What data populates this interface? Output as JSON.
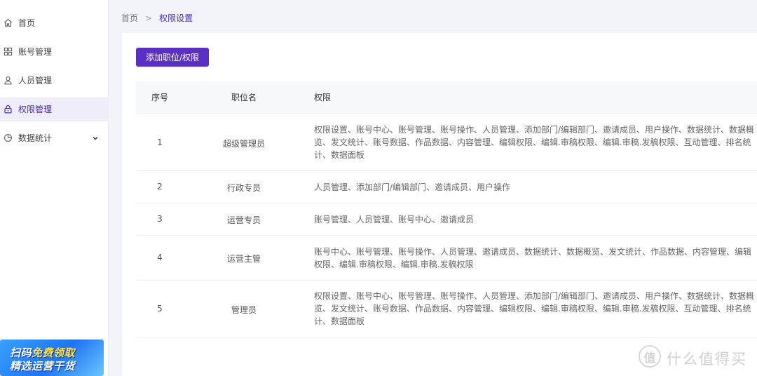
{
  "sidebar": {
    "items": [
      {
        "label": "首页",
        "icon": "home-icon"
      },
      {
        "label": "账号管理",
        "icon": "grid-icon"
      },
      {
        "label": "人员管理",
        "icon": "user-icon"
      },
      {
        "label": "权限管理",
        "icon": "lock-icon",
        "active": true
      },
      {
        "label": "数据统计",
        "icon": "chart-icon"
      }
    ],
    "promo": {
      "line1_a": "扫码",
      "line1_b": "免费领取",
      "line2": "精选运营干货"
    }
  },
  "breadcrumb": {
    "home": "首页",
    "separator": ">",
    "current": "权限设置"
  },
  "toolbar": {
    "add_label": "添加职位/权限"
  },
  "table": {
    "headers": {
      "index": "序号",
      "name": "职位名",
      "permissions": "权限"
    },
    "rows": [
      {
        "index": "1",
        "name": "超级管理员",
        "permissions": "权限设置、账号中心、账号管理、账号操作、人员管理、添加部门/编辑部门、邀请成员、用户操作、数据统计、数据概览、发文统计、账号数据、作品数据、内容管理、编辑权限、编辑.审稿权限、编辑.审稿.发稿权限、互动管理、排名统计、数据面板"
      },
      {
        "index": "2",
        "name": "行政专员",
        "permissions": "人员管理、添加部门/编辑部门、邀请成员、用户操作"
      },
      {
        "index": "3",
        "name": "运营专员",
        "permissions": "账号管理、人员管理、账号中心、邀请成员"
      },
      {
        "index": "4",
        "name": "运营主管",
        "permissions": "账号中心、账号管理、账号操作、人员管理、邀请成员、数据统计、数据概览、发文统计、作品数据、内容管理、编辑权限、编辑.审稿权限、编辑.审稿.发稿权限"
      },
      {
        "index": "5",
        "name": "管理员",
        "permissions": "权限设置、账号中心、账号管理、账号操作、人员管理、添加部门/编辑部门、邀请成员、用户操作、数据统计、数据概览、发文统计、账号数据、作品数据、内容管理、编辑权限、编辑.审稿权限、编辑.审稿.发稿权限、互动管理、排名统计、数据面板"
      }
    ]
  },
  "watermark": {
    "mark": "值",
    "text": "什么值得买"
  },
  "colors": {
    "accent": "#5a2fc3",
    "active_bg": "#efedf9",
    "page_bg": "#f3f4f9"
  }
}
